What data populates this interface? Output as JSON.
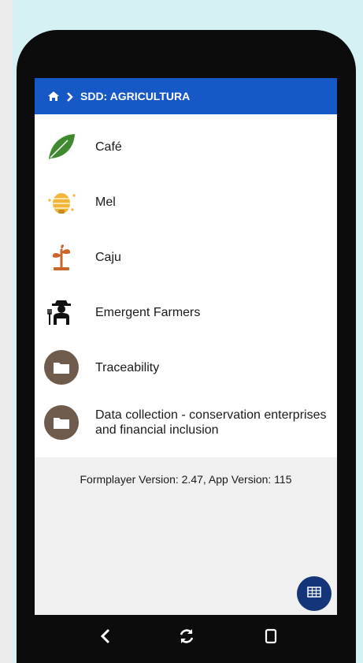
{
  "header": {
    "breadcrumb": "SDD: AGRICULTURA",
    "home_icon": "home-icon",
    "separator_icon": "chevron-right-icon"
  },
  "menu": {
    "items": [
      {
        "label": "Café",
        "icon": "leaf-icon"
      },
      {
        "label": "Mel",
        "icon": "beehive-icon"
      },
      {
        "label": "Caju",
        "icon": "sprout-icon"
      },
      {
        "label": "Emergent Farmers",
        "icon": "farmer-icon"
      },
      {
        "label": "Traceability",
        "icon": "folder-icon"
      },
      {
        "label": "Data collection - conservation enterprises and financial inclusion",
        "icon": "folder-icon"
      }
    ]
  },
  "footer": {
    "version_text": "Formplayer Version: 2.47, App Version: 115"
  },
  "fab": {
    "icon": "grid-icon"
  },
  "navbar": {
    "back_icon": "back-icon",
    "refresh_icon": "refresh-icon",
    "recent_icon": "square-icon"
  },
  "colors": {
    "header": "#1658c6",
    "fab": "#14357a",
    "folder": "#6f5b4c",
    "leaf": "#3f8a2f",
    "bee": "#f3b43a",
    "sprout": "#c9652b"
  }
}
